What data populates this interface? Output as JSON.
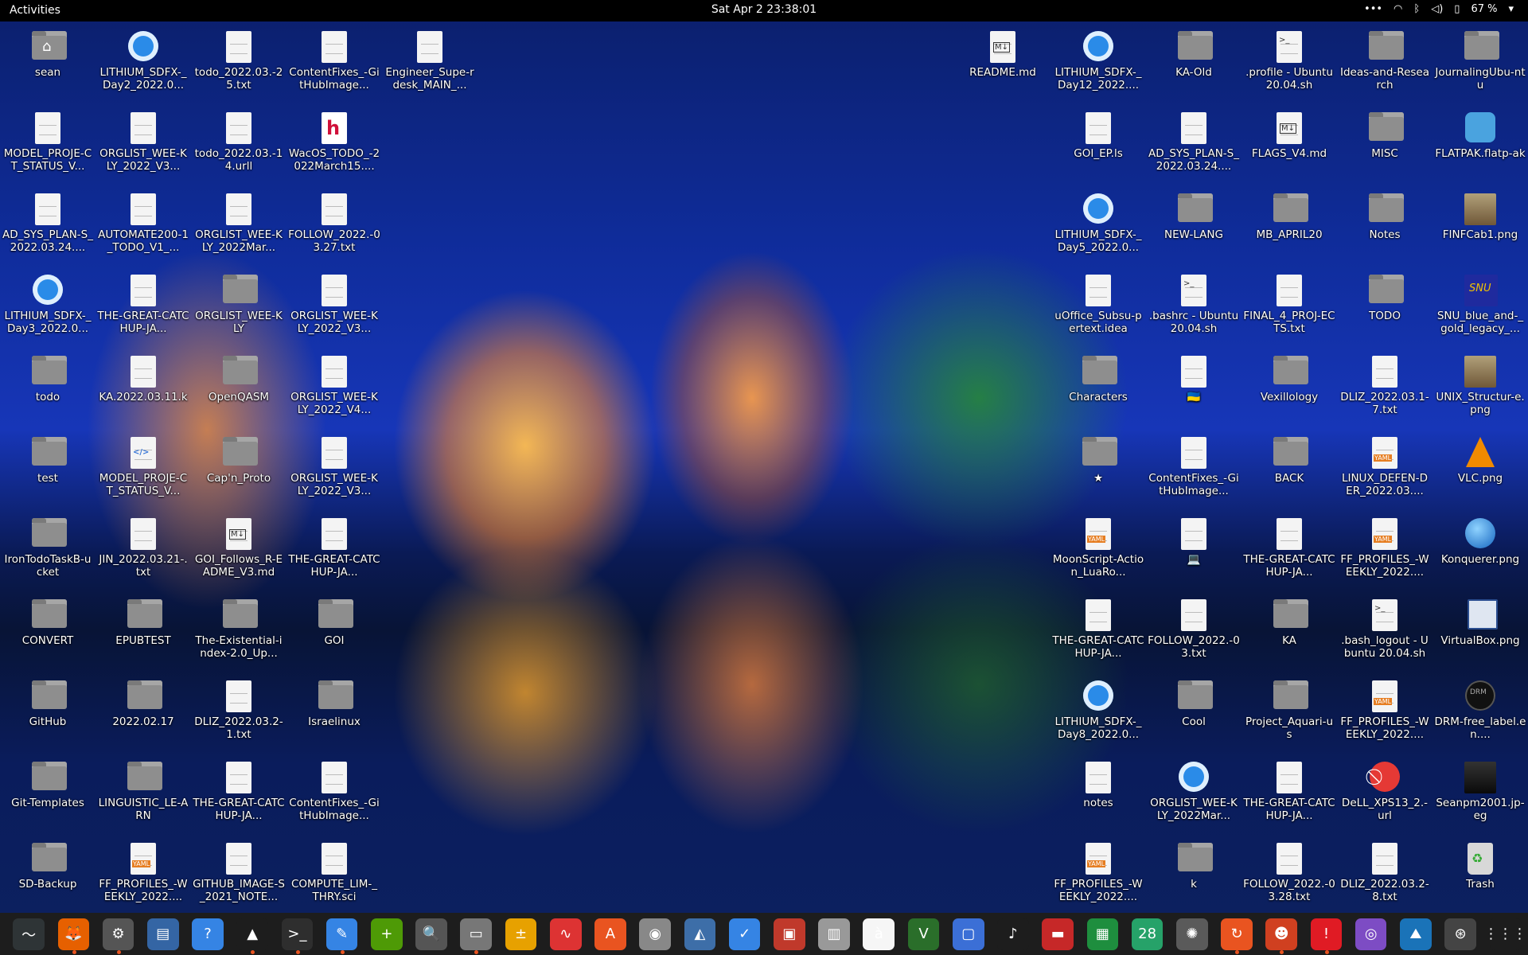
{
  "topbar": {
    "activities": "Activities",
    "clock": "Sat Apr 2  23:38:01",
    "battery": "67 %",
    "menu_icon": "ellipsis-icon",
    "tray_icons": [
      "wifi-icon",
      "bluetooth-icon",
      "volume-icon",
      "battery-icon"
    ]
  },
  "desktop": {
    "left_columns": [
      [
        {
          "label": "sean",
          "type": "home"
        },
        {
          "label": "MODEL_PROJE-CT_STATUS_V...",
          "type": "file"
        },
        {
          "label": "AD_SYS_PLAN-S_2022.03.24....",
          "type": "file"
        },
        {
          "label": "LITHIUM_SDFX-_Day3_2022.0...",
          "type": "app"
        },
        {
          "label": "todo",
          "type": "folder"
        },
        {
          "label": "test",
          "type": "folder"
        },
        {
          "label": "IronTodoTaskB-ucket",
          "type": "folder"
        },
        {
          "label": "CONVERT",
          "type": "folder"
        },
        {
          "label": "GitHub",
          "type": "folder"
        },
        {
          "label": "Git-Templates",
          "type": "folder"
        },
        {
          "label": "SD-Backup",
          "type": "folder"
        }
      ],
      [
        {
          "label": "LITHIUM_SDFX-_Day2_2022.0...",
          "type": "app"
        },
        {
          "label": "ORGLIST_WEE-KLY_2022_V3...",
          "type": "file"
        },
        {
          "label": "AUTOMATE200-1_TODO_V1_...",
          "type": "file"
        },
        {
          "label": "THE-GREAT-CATCHUP-JA...",
          "type": "file"
        },
        {
          "label": "KA.2022.03.11.k",
          "type": "file"
        },
        {
          "label": "MODEL_PROJE-CT_STATUS_V...",
          "type": "code"
        },
        {
          "label": "JIN_2022.03.21-.txt",
          "type": "file"
        },
        {
          "label": "EPUBTEST",
          "type": "folder"
        },
        {
          "label": "2022.02.17",
          "type": "folder"
        },
        {
          "label": "LINGUISTIC_LE-ARN",
          "type": "folder"
        },
        {
          "label": "FF_PROFILES_-WEEKLY_2022....",
          "type": "yaml"
        }
      ],
      [
        {
          "label": "todo_2022.03.-25.txt",
          "type": "file"
        },
        {
          "label": "todo_2022.03.-14.urll",
          "type": "file"
        },
        {
          "label": "ORGLIST_WEE-KLY_2022Mar...",
          "type": "file"
        },
        {
          "label": "ORGLIST_WEE-KLY",
          "type": "folder"
        },
        {
          "label": "OpenQASM",
          "type": "folder"
        },
        {
          "label": "Cap'n_Proto",
          "type": "folder"
        },
        {
          "label": "GOI_Follows_R-EADME_V3.md",
          "type": "md"
        },
        {
          "label": "The-Existential-index-2.0_Up...",
          "type": "folder"
        },
        {
          "label": "DLIZ_2022.03.2-1.txt",
          "type": "file"
        },
        {
          "label": "THE-GREAT-CATCHUP-JA...",
          "type": "file"
        },
        {
          "label": "GITHUB_IMAGE-S_2021_NOTE...",
          "type": "file"
        }
      ],
      [
        {
          "label": "ContentFixes_-GitHubImage...",
          "type": "file"
        },
        {
          "label": "WacOS_TODO_-2022March15....",
          "type": "h"
        },
        {
          "label": "FOLLOW_2022.-03.27.txt",
          "type": "file"
        },
        {
          "label": "ORGLIST_WEE-KLY_2022_V3...",
          "type": "file"
        },
        {
          "label": "ORGLIST_WEE-KLY_2022_V4...",
          "type": "file"
        },
        {
          "label": "ORGLIST_WEE-KLY_2022_V3...",
          "type": "file"
        },
        {
          "label": "THE-GREAT-CATCHUP-JA...",
          "type": "file"
        },
        {
          "label": "GOI",
          "type": "folder"
        },
        {
          "label": "Israelinux",
          "type": "folder"
        },
        {
          "label": "ContentFixes_-GitHubImage...",
          "type": "file"
        },
        {
          "label": "COMPUTE_LIM-_THRY.sci",
          "type": "file"
        }
      ],
      [
        {
          "label": "Engineer_Supe-rdesk_MAIN_...",
          "type": "file"
        }
      ]
    ],
    "right_columns": [
      [
        {
          "label": "README.md",
          "type": "md"
        }
      ],
      [
        {
          "label": "LITHIUM_SDFX-_Day12_2022....",
          "type": "app"
        },
        {
          "label": "GOI_EP.ls",
          "type": "file"
        },
        {
          "label": "LITHIUM_SDFX-_Day5_2022.0...",
          "type": "app"
        },
        {
          "label": "uOffice_Subsu-pertext.idea",
          "type": "file"
        },
        {
          "label": "Characters",
          "type": "folder"
        },
        {
          "label": "★",
          "type": "folder"
        },
        {
          "label": "MoonScript-Action_LuaRo...",
          "type": "yaml"
        },
        {
          "label": "THE-GREAT-CATCHUP-JA...",
          "type": "file"
        },
        {
          "label": "LITHIUM_SDFX-_Day8_2022.0...",
          "type": "app"
        },
        {
          "label": "notes",
          "type": "file"
        },
        {
          "label": "FF_PROFILES_-WEEKLY_2022....",
          "type": "yaml"
        }
      ],
      [
        {
          "label": "KA-Old",
          "type": "folder"
        },
        {
          "label": "AD_SYS_PLAN-S_2022.03.24....",
          "type": "file"
        },
        {
          "label": "NEW-LANG",
          "type": "folder"
        },
        {
          "label": ".bashrc - Ubuntu 20.04.sh",
          "type": "sh"
        },
        {
          "label": "🇺🇦",
          "type": "file"
        },
        {
          "label": "ContentFixes_-GitHubImage...",
          "type": "file"
        },
        {
          "label": "💻",
          "type": "file"
        },
        {
          "label": "FOLLOW_2022.-03.txt",
          "type": "file"
        },
        {
          "label": "Cool",
          "type": "folder"
        },
        {
          "label": "ORGLIST_WEE-KLY_2022Mar...",
          "type": "app"
        },
        {
          "label": "k",
          "type": "folder"
        }
      ],
      [
        {
          "label": ".profile - Ubuntu 20.04.sh",
          "type": "sh"
        },
        {
          "label": "FLAGS_V4.md",
          "type": "md"
        },
        {
          "label": "MB_APRIL20",
          "type": "folder"
        },
        {
          "label": "FINAL_4_PROJ-ECTS.txt",
          "type": "file"
        },
        {
          "label": "Vexillology",
          "type": "folder"
        },
        {
          "label": "BACK",
          "type": "folder"
        },
        {
          "label": "THE-GREAT-CATCHUP-JA...",
          "type": "file"
        },
        {
          "label": "KA",
          "type": "folder"
        },
        {
          "label": "Project_Aquari-us",
          "type": "folder"
        },
        {
          "label": "THE-GREAT-CATCHUP-JA...",
          "type": "file"
        },
        {
          "label": "FOLLOW_2022.-03.28.txt",
          "type": "file"
        }
      ],
      [
        {
          "label": "Ideas-and-Research",
          "type": "folder"
        },
        {
          "label": "MISC",
          "type": "folder"
        },
        {
          "label": "Notes",
          "type": "folder"
        },
        {
          "label": "TODO",
          "type": "folder"
        },
        {
          "label": "DLIZ_2022.03.1-7.txt",
          "type": "file"
        },
        {
          "label": "LINUX_DEFEN-DER_2022.03....",
          "type": "yaml"
        },
        {
          "label": "FF_PROFILES_-WEEKLY_2022....",
          "type": "yaml"
        },
        {
          "label": ".bash_logout - Ubuntu 20.04.sh",
          "type": "sh"
        },
        {
          "label": "FF_PROFILES_-WEEKLY_2022....",
          "type": "yaml"
        },
        {
          "label": "DeLL_XPS13_2.-url",
          "type": "red"
        },
        {
          "label": "DLIZ_2022.03.2-8.txt",
          "type": "file"
        }
      ],
      [
        {
          "label": "JournalingUbu-ntu",
          "type": "folder"
        },
        {
          "label": "FLATPAK.flatp-ak",
          "type": "flatpak"
        },
        {
          "label": "FINFCab1.png",
          "type": "image"
        },
        {
          "label": "SNU_blue_and-_gold_legacy_...",
          "type": "snu"
        },
        {
          "label": "UNIX_Structur-e.png",
          "type": "image"
        },
        {
          "label": "VLC.png",
          "type": "vlc"
        },
        {
          "label": "Konquerer.png",
          "type": "globe"
        },
        {
          "label": "VirtualBox.png",
          "type": "vbox"
        },
        {
          "label": "DRM-free_label.en....",
          "type": "drm"
        },
        {
          "label": "Seanpm2001.jp-eg",
          "type": "photo"
        },
        {
          "label": "Trash",
          "type": "trash"
        }
      ]
    ]
  },
  "dock": [
    {
      "name": "system-monitor-icon",
      "color": "#2e3436",
      "glyph": "〜",
      "running": false
    },
    {
      "name": "firefox-icon",
      "color": "#e66000",
      "glyph": "🦊",
      "running": true
    },
    {
      "name": "settings-icon",
      "color": "#555555",
      "glyph": "⚙",
      "running": true
    },
    {
      "name": "document-viewer-icon",
      "color": "#3465a4",
      "glyph": "▤",
      "running": false
    },
    {
      "name": "help-icon",
      "color": "#3584e4",
      "glyph": "?",
      "running": false
    },
    {
      "name": "vlc-icon",
      "color": "#1d1d1d",
      "glyph": "▲",
      "running": true
    },
    {
      "name": "terminal-icon",
      "color": "#2e2e2e",
      "glyph": ">_",
      "running": true
    },
    {
      "name": "text-editor-icon",
      "color": "#3584e4",
      "glyph": "✎",
      "running": true
    },
    {
      "name": "add-app-icon",
      "color": "#4e9a06",
      "glyph": "+",
      "running": false
    },
    {
      "name": "image-viewer-icon",
      "color": "#555555",
      "glyph": "🔍",
      "running": false
    },
    {
      "name": "files-icon",
      "color": "#777777",
      "glyph": "▭",
      "running": true
    },
    {
      "name": "calculator-icon",
      "color": "#e7a100",
      "glyph": "±",
      "running": false
    },
    {
      "name": "monitor-chart-icon",
      "color": "#d33",
      "glyph": "∿",
      "running": false
    },
    {
      "name": "software-store-icon",
      "color": "#e95420",
      "glyph": "A",
      "running": false
    },
    {
      "name": "disk-icon",
      "color": "#888888",
      "glyph": "◉",
      "running": false
    },
    {
      "name": "scanner-icon",
      "color": "#3d6ea8",
      "glyph": "◭",
      "running": false
    },
    {
      "name": "todo-icon",
      "color": "#3584e4",
      "glyph": "✓",
      "running": false
    },
    {
      "name": "screenshot-icon",
      "color": "#c0392b",
      "glyph": "▣",
      "running": false
    },
    {
      "name": "archive-icon",
      "color": "#999999",
      "glyph": "▥",
      "running": false
    },
    {
      "name": "characters-icon",
      "color": "#f6f6f6",
      "glyph": "à",
      "running": false
    },
    {
      "name": "vim-icon",
      "color": "#2a6e2a",
      "glyph": "V",
      "running": false
    },
    {
      "name": "workspaces-icon",
      "color": "#3b6fd6",
      "glyph": "▢",
      "running": false
    },
    {
      "name": "music-icon",
      "color": "#1d1d1d",
      "glyph": "♪",
      "running": false
    },
    {
      "name": "pdf-icon",
      "color": "#c62828",
      "glyph": "▬",
      "running": false
    },
    {
      "name": "spreadsheet-icon",
      "color": "#1e8e3e",
      "glyph": "▦",
      "running": false
    },
    {
      "name": "calendar-icon",
      "color": "#26a269",
      "glyph": "28",
      "running": false
    },
    {
      "name": "gimp-icon",
      "color": "#5a5a5a",
      "glyph": "✺",
      "running": false
    },
    {
      "name": "updater-icon",
      "color": "#e95420",
      "glyph": "↻",
      "running": true
    },
    {
      "name": "game-icon",
      "color": "#d04020",
      "glyph": "☻",
      "running": true
    },
    {
      "name": "error-icon",
      "color": "#e01b24",
      "glyph": "!",
      "running": true
    },
    {
      "name": "camera-icon",
      "color": "#7d4cc4",
      "glyph": "◎",
      "running": false
    },
    {
      "name": "weather-icon",
      "color": "#1a73b8",
      "glyph": "⛰",
      "running": false
    },
    {
      "name": "steam-icon",
      "color": "#444444",
      "glyph": "⊛",
      "running": false
    },
    {
      "name": "show-apps-icon",
      "color": "#1d1d1d",
      "glyph": "⋮⋮⋮",
      "running": false
    }
  ]
}
